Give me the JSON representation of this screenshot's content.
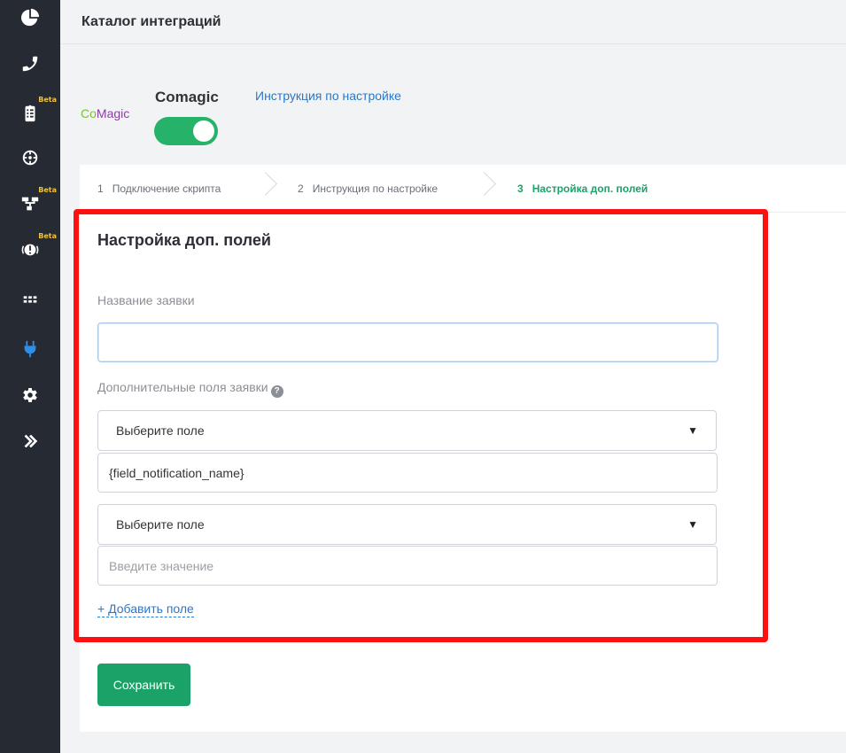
{
  "sidebar": {
    "items": [
      {
        "icon": "pie-chart-icon"
      },
      {
        "icon": "phone-icon"
      },
      {
        "icon": "clipboard-icon",
        "badge": "Beta"
      },
      {
        "icon": "crosshair-icon"
      },
      {
        "icon": "sitemap-icon",
        "badge": "Beta"
      },
      {
        "icon": "alert-icon",
        "badge": "Beta"
      },
      {
        "icon": "apps-grid-icon"
      },
      {
        "icon": "plug-icon",
        "active": true
      },
      {
        "icon": "gear-icon"
      },
      {
        "icon": "double-chevron-right-icon"
      }
    ]
  },
  "header": {
    "title": "Каталог интеграций"
  },
  "integration": {
    "logo_co": "Co",
    "logo_magic": "Magic",
    "name": "Comagic",
    "instruction_link": "Инструкция по настройке",
    "enabled": true
  },
  "steps": [
    {
      "num": "1",
      "label": "Подключение скрипта"
    },
    {
      "num": "2",
      "label": "Инструкция по настройке"
    },
    {
      "num": "3",
      "label": "Настройка доп. полей",
      "active": true
    }
  ],
  "form": {
    "title": "Настройка доп. полей",
    "request_name_label": "Название заявки",
    "request_name_value": "",
    "extra_fields_label": "Дополнительные поля заявки",
    "field1_select": "Выберите поле",
    "field1_value": "{field_notification_name}",
    "field2_select": "Выберите поле",
    "field2_placeholder": "Введите значение",
    "add_field": "+ Добавить поле",
    "select_arrow": "▼",
    "help": "?"
  },
  "actions": {
    "save": "Сохранить"
  },
  "colors": {
    "accent": "#1aa268",
    "link": "#2a78c9",
    "sidebar": "#262a33",
    "highlight": "#ff1010"
  }
}
